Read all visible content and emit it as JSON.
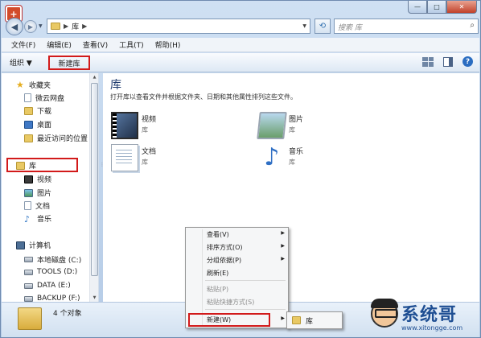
{
  "window": {
    "address_crumb": "库",
    "search_placeholder": "搜索 库",
    "controls": {
      "minimize": "—",
      "maximize": "□",
      "close": "✕"
    }
  },
  "menubar": [
    "文件(F)",
    "编辑(E)",
    "查看(V)",
    "工具(T)",
    "帮助(H)"
  ],
  "commandbar": {
    "organize": "组织 ▼",
    "new_library": "新建库"
  },
  "navpane": {
    "favorites": {
      "label": "收藏夹",
      "items": [
        "微云网盘",
        "下载",
        "桌面",
        "最近访问的位置"
      ]
    },
    "libraries": {
      "label": "库",
      "items": [
        "视频",
        "图片",
        "文档",
        "音乐"
      ]
    },
    "computer": {
      "label": "计算机",
      "items": [
        "本地磁盘 (C:)",
        "TOOLS (D:)",
        "DATA (E:)",
        "BACKUP (F:)"
      ]
    }
  },
  "content": {
    "title": "库",
    "description": "打开库以查看文件并根据文件夹、日期和其他属性排列这些文件。",
    "tiles": [
      {
        "name": "视频",
        "sub": "库",
        "icon": "video-library-icon"
      },
      {
        "name": "图片",
        "sub": "库",
        "icon": "picture-library-icon"
      },
      {
        "name": "文档",
        "sub": "库",
        "icon": "document-library-icon"
      },
      {
        "name": "音乐",
        "sub": "库",
        "icon": "music-library-icon"
      }
    ]
  },
  "statusbar": {
    "count": "4 个对象"
  },
  "context_menu": {
    "items": [
      "查看(V)",
      "排序方式(O)",
      "分组依据(P)",
      "刷新(E)",
      "粘贴(P)",
      "粘贴快捷方式(S)",
      "新建(W)"
    ],
    "submenu_item": "库"
  },
  "watermark": {
    "brand": "系统哥",
    "url": "www.xitongge.com"
  },
  "colors": {
    "accent_title": "#1e3a6e",
    "highlight_red": "#d21a1a",
    "window_frame": "#b5cbe6"
  }
}
